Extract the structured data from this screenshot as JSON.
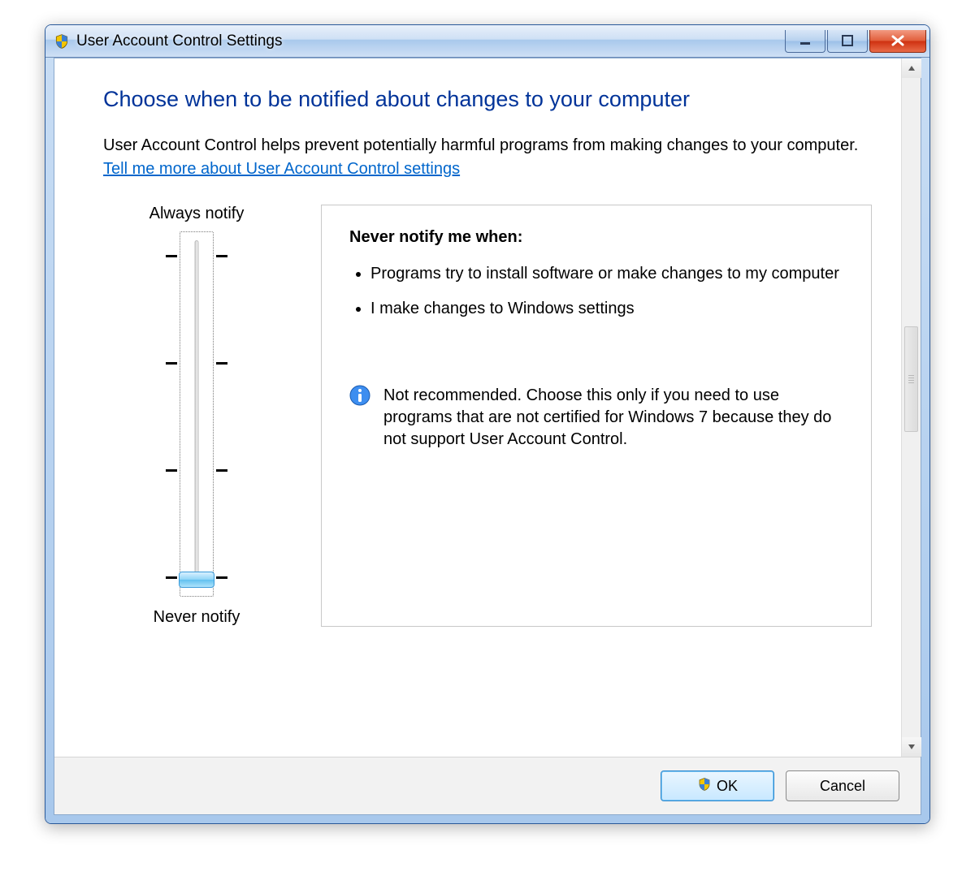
{
  "window": {
    "title": "User Account Control Settings"
  },
  "page": {
    "heading": "Choose when to be notified about changes to your computer",
    "intro": "User Account Control helps prevent potentially harmful programs from making changes to your computer.",
    "help_link": "Tell me more about User Account Control settings"
  },
  "slider": {
    "top_label": "Always notify",
    "bottom_label": "Never notify",
    "levels": 4,
    "current_level": 0
  },
  "detail": {
    "heading": "Never notify me when:",
    "bullets": [
      "Programs try to install software or make changes to my computer",
      "I make changes to Windows settings"
    ],
    "info": "Not recommended. Choose this only if you need to use programs that are not certified for Windows 7 because they do not support User Account Control."
  },
  "buttons": {
    "ok": "OK",
    "cancel": "Cancel"
  }
}
